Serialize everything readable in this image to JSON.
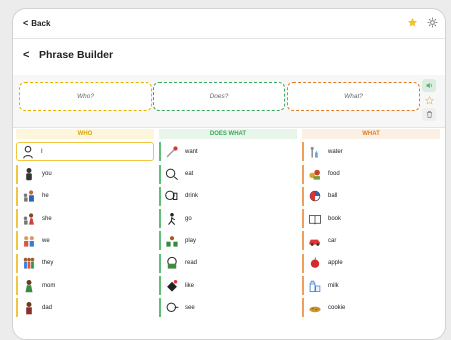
{
  "nav": {
    "back_label": "Back"
  },
  "page": {
    "title": "Phrase Builder"
  },
  "slots": {
    "who": "Who?",
    "does": "Does?",
    "what": "What?"
  },
  "columns": {
    "who": {
      "header": "WHO",
      "items": [
        "I",
        "you",
        "he",
        "she",
        "we",
        "they",
        "mom",
        "dad"
      ]
    },
    "does": {
      "header": "DOES WHAT",
      "items": [
        "want",
        "eat",
        "drink",
        "go",
        "play",
        "read",
        "like",
        "see"
      ]
    },
    "what": {
      "header": "WHAT",
      "items": [
        "water",
        "food",
        "ball",
        "book",
        "car",
        "apple",
        "milk",
        "cookie"
      ]
    }
  },
  "colors": {
    "who": "#e8b100",
    "does": "#3aa85b",
    "what": "#e07b25",
    "star": "#f2c230"
  }
}
